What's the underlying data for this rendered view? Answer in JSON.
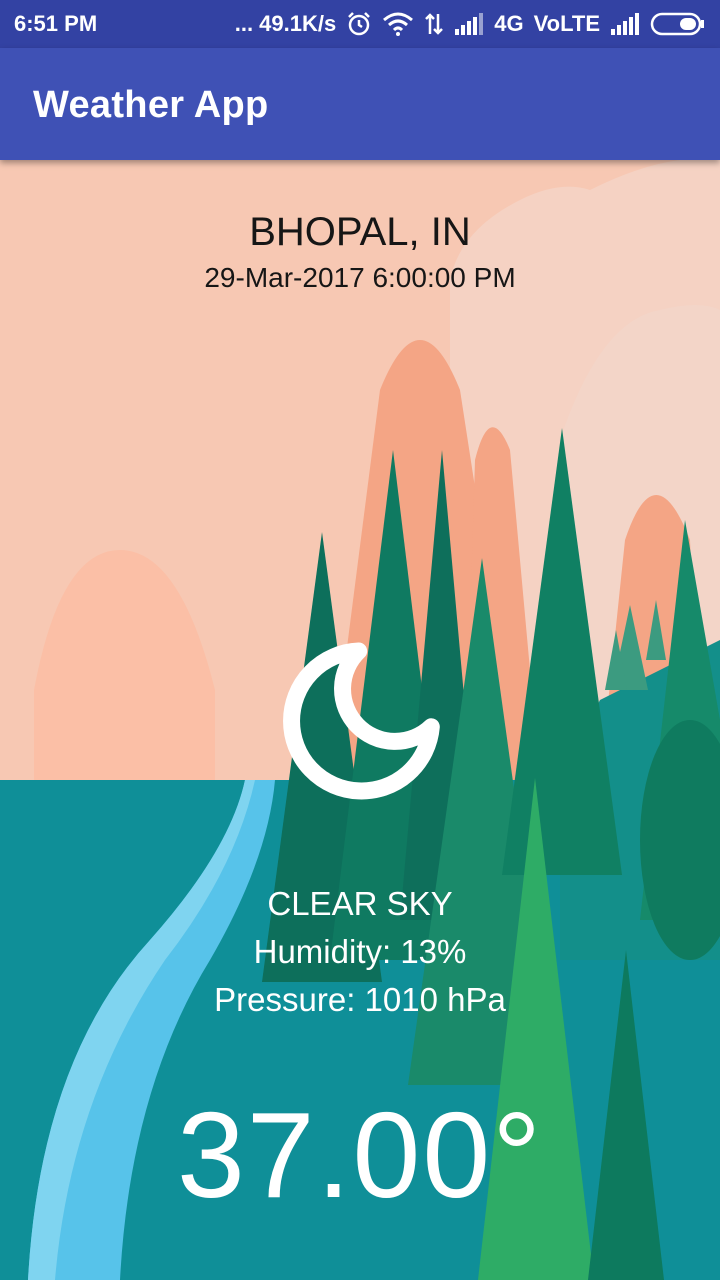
{
  "status_bar": {
    "time": "6:51 PM",
    "net_speed": "... 49.1K/s",
    "network_type": "4G",
    "volte": "VoLTE"
  },
  "app_bar": {
    "title": "Weather App"
  },
  "weather": {
    "location": "BHOPAL, IN",
    "datetime": "29-Mar-2017 6:00:00 PM",
    "condition": "CLEAR SKY",
    "humidity": "Humidity: 13%",
    "pressure": "Pressure: 1010 hPa",
    "temperature": "37.00°",
    "icon": "clear-night-moon-icon"
  },
  "colors": {
    "status_bar": "#3342a3",
    "app_bar": "#3f51b5",
    "sky": "#f8c9b3",
    "water": "#0f8f98"
  }
}
